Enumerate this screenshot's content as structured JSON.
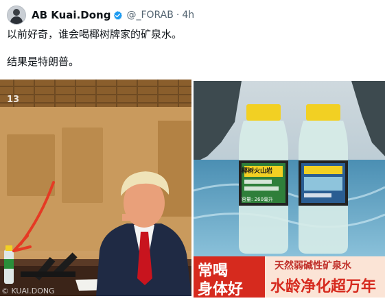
{
  "post": {
    "author_name": "AB Kuai.Dong",
    "handle": "@_FORAB",
    "separator": "·",
    "time": "4h",
    "text_line1": "以前好奇，谁会喝椰树牌家的矿泉水。",
    "text_line2": "结果是特朗普。"
  },
  "media": {
    "left_image": {
      "description": "video-frame",
      "channel_badge": "13",
      "watermark": "© KUAI.DONG"
    },
    "right_image": {
      "bottle_label": "椰树火山岩",
      "bottle_volume": "容量: 260毫升",
      "banner_left_line1": "常喝",
      "banner_left_line2": "身体好",
      "banner_right_top": "天然弱碱性矿泉水",
      "banner_right_bottom": "水龄净化超万年"
    }
  },
  "colors": {
    "verified_blue": "#1d9bf0",
    "banner_red": "#d62a1e",
    "cap_yellow": "#f2d023",
    "arrow_red": "#e53a24"
  }
}
